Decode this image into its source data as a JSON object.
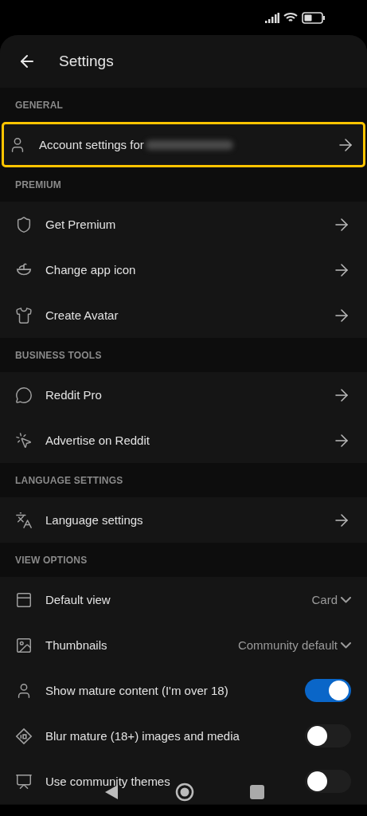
{
  "header": {
    "title": "Settings"
  },
  "sections": [
    {
      "title": "GENERAL",
      "items": [
        {
          "kind": "link",
          "label": "Account settings for",
          "redacted": true,
          "highlighted": true
        }
      ]
    },
    {
      "title": "PREMIUM",
      "items": [
        {
          "kind": "link",
          "label": "Get Premium",
          "highlighted": false
        },
        {
          "kind": "link",
          "label": "Change app icon",
          "highlighted": false
        },
        {
          "kind": "link",
          "label": "Create Avatar",
          "highlighted": false
        }
      ]
    },
    {
      "title": "BUSINESS TOOLS",
      "items": [
        {
          "kind": "link",
          "label": "Reddit Pro",
          "highlighted": false
        },
        {
          "kind": "link",
          "label": "Advertise on Reddit",
          "highlighted": false
        }
      ]
    },
    {
      "title": "LANGUAGE SETTINGS",
      "items": [
        {
          "kind": "link",
          "label": "Language settings",
          "highlighted": false
        }
      ]
    },
    {
      "title": "VIEW OPTIONS",
      "items": [
        {
          "kind": "dropdown",
          "label": "Default view",
          "value": "Card",
          "highlighted": false
        },
        {
          "kind": "dropdown",
          "label": "Thumbnails",
          "value": "Community default",
          "highlighted": false
        },
        {
          "kind": "toggle",
          "label": "Show mature content (I'm over 18)",
          "on": true,
          "highlighted": false
        },
        {
          "kind": "toggle",
          "label": "Blur mature (18+) images and media",
          "on": false,
          "highlighted": false
        },
        {
          "kind": "toggle",
          "label": "Use community themes",
          "on": false,
          "highlighted": false
        }
      ]
    }
  ]
}
